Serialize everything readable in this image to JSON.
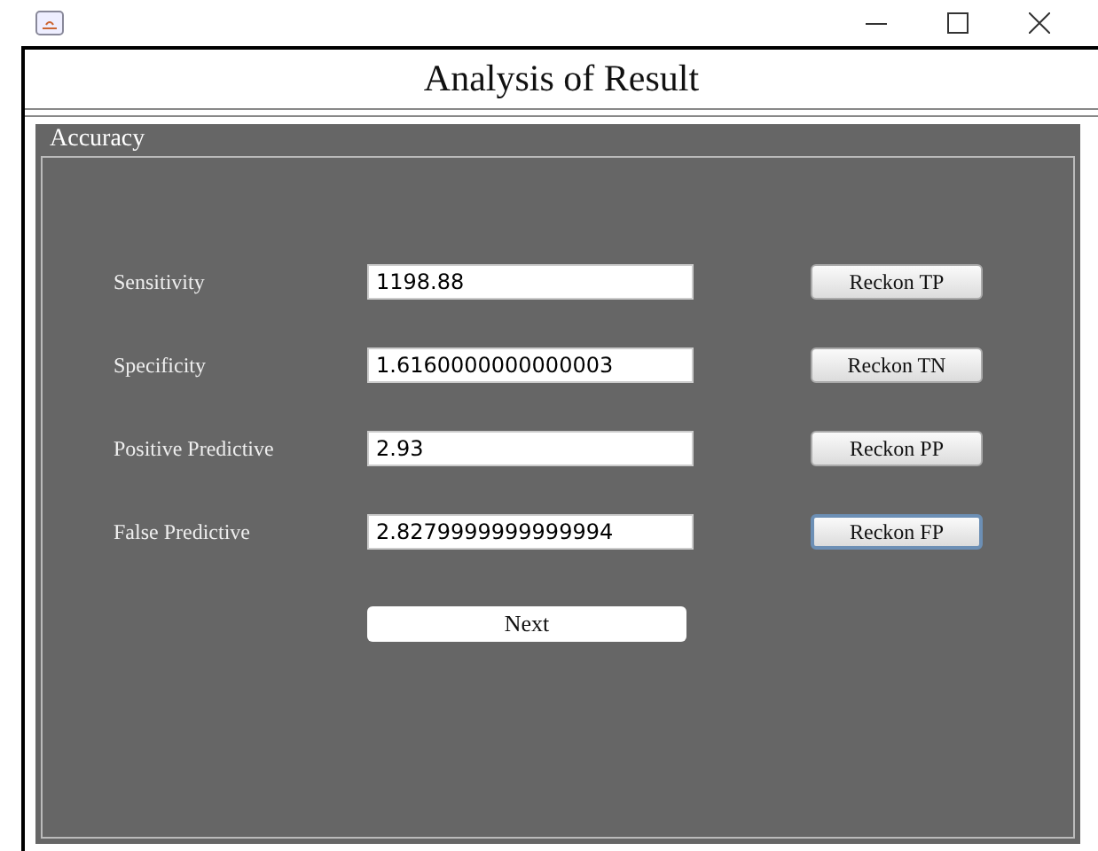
{
  "header": {
    "title": "Analysis of Result"
  },
  "panel": {
    "title": "Accuracy",
    "rows": [
      {
        "label": "Sensitivity",
        "value": "1198.88",
        "button": "Reckon TP",
        "focused": false
      },
      {
        "label": "Specificity",
        "value": "1.6160000000000003",
        "button": "Reckon TN",
        "focused": false
      },
      {
        "label": "Positive Predictive",
        "value": "2.93",
        "button": "Reckon PP",
        "focused": false
      },
      {
        "label": "False Predictive",
        "value": "2.8279999999999994",
        "button": "Reckon FP",
        "focused": true
      }
    ],
    "next_button": "Next"
  }
}
